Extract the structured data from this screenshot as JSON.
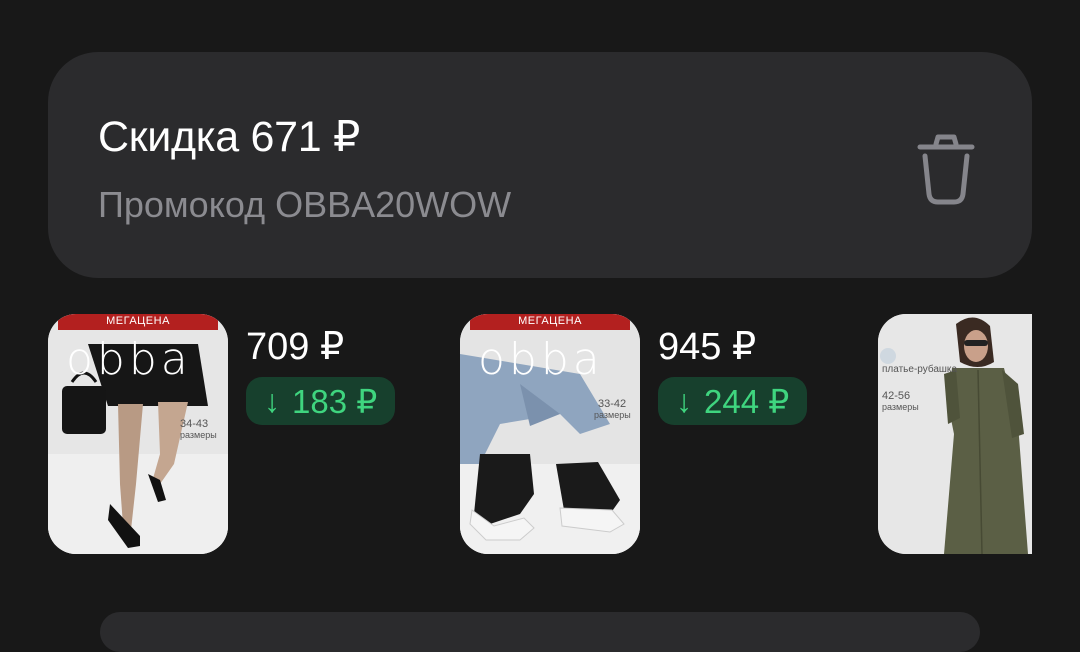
{
  "promo": {
    "title": "Скидка 671 ₽",
    "code_line": "Промокод OBBA20WOW",
    "delete_icon": "trash-icon"
  },
  "products": [
    {
      "badge": "МЕГАЦЕНА",
      "brand": "obba",
      "sizes": "34-43",
      "sizes_caption": "размеры",
      "price": "709 ₽",
      "drop_arrow": "↓",
      "drop": "183 ₽"
    },
    {
      "badge": "МЕГАЦЕНА",
      "brand": "obba",
      "sizes": "33-42",
      "sizes_caption": "размеры",
      "price": "945 ₽",
      "drop_arrow": "↓",
      "drop": "244 ₽"
    },
    {
      "label": "платье-рубашка",
      "sizes": "42-56",
      "sizes_caption": "размеры"
    }
  ],
  "colors": {
    "background": "#181818",
    "card": "#2b2b2d",
    "badge_red": "#b3201f",
    "drop_bg": "#17402d",
    "drop_text": "#3fd57f"
  }
}
